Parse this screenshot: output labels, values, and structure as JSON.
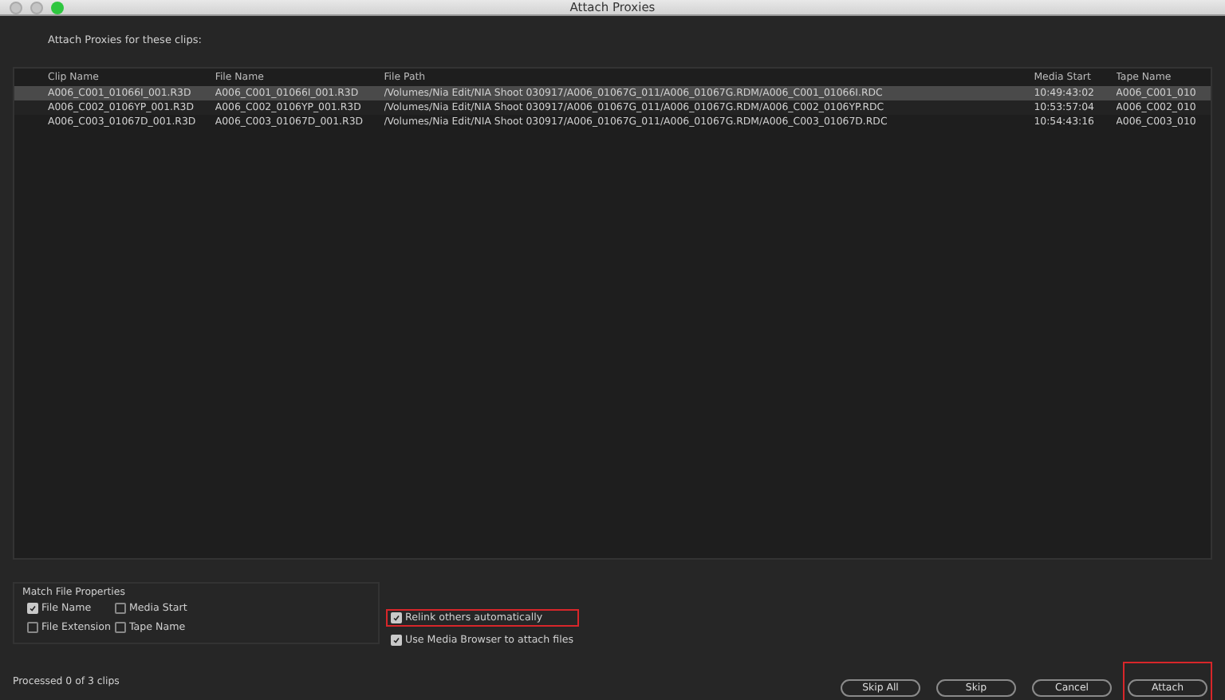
{
  "window": {
    "title": "Attach Proxies"
  },
  "instruction": "Attach Proxies for these clips:",
  "table": {
    "columns": [
      "Clip Name",
      "File Name",
      "File Path",
      "Media Start",
      "Tape Name"
    ],
    "rows": [
      {
        "cells": [
          "A006_C001_01066I_001.R3D",
          "A006_C001_01066I_001.R3D",
          "/Volumes/Nia Edit/NIA Shoot 030917/A006_01067G_011/A006_01067G.RDM/A006_C001_01066I.RDC",
          "10:49:43:02",
          "A006_C001_010"
        ],
        "selected": true
      },
      {
        "cells": [
          "A006_C002_0106YP_001.R3D",
          "A006_C002_0106YP_001.R3D",
          "/Volumes/Nia Edit/NIA Shoot 030917/A006_01067G_011/A006_01067G.RDM/A006_C002_0106YP.RDC",
          "10:53:57:04",
          "A006_C002_010"
        ],
        "selected": false
      },
      {
        "cells": [
          "A006_C003_01067D_001.R3D",
          "A006_C003_01067D_001.R3D",
          "/Volumes/Nia Edit/NIA Shoot 030917/A006_01067G_011/A006_01067G.RDM/A006_C003_01067D.RDC",
          "10:54:43:16",
          "A006_C003_010"
        ],
        "selected": false
      }
    ]
  },
  "match_file_properties": {
    "title": "Match File Properties",
    "options": [
      {
        "label": "File Name",
        "checked": true
      },
      {
        "label": "Media Start",
        "checked": false
      },
      {
        "label": "File Extension",
        "checked": false
      },
      {
        "label": "Tape Name",
        "checked": false
      }
    ]
  },
  "options": [
    {
      "label": "Relink others automatically",
      "checked": true,
      "highlighted": true
    },
    {
      "label": "Use Media Browser to attach files",
      "checked": true,
      "highlighted": false
    }
  ],
  "status": "Processed 0 of 3 clips",
  "buttons": [
    {
      "label": "Skip All",
      "highlighted": false
    },
    {
      "label": "Skip",
      "highlighted": false
    },
    {
      "label": "Cancel",
      "highlighted": false
    },
    {
      "label": "Attach",
      "highlighted": true
    }
  ]
}
